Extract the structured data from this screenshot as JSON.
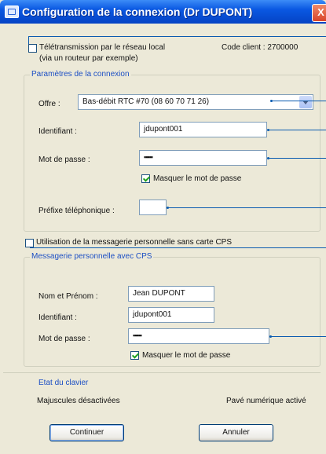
{
  "window": {
    "title": "Configuration de la connexion (Dr DUPONT)",
    "close_glyph": "X"
  },
  "telematic": {
    "checkbox_label_line1": "Télétransmission par le réseau local",
    "checkbox_label_line2": "(via un routeur par exemple)",
    "checked": false,
    "client_code_label": "Code client : 2700000"
  },
  "connection": {
    "group_title": "Paramètres de la connexion",
    "offer_label": "Offre :",
    "offer_value": "Bas-débit RTC #70 (08 60 70 71 26)",
    "identifier_label": "Identifiant :",
    "identifier_value": "jdupont001",
    "password_label": "Mot de passe :",
    "password_value": "▪▪▪▪▪",
    "mask_password_label": "Masquer le mot de passe",
    "mask_password_checked": true,
    "phone_prefix_label": "Préfixe téléphonique :",
    "phone_prefix_value": ""
  },
  "messaging": {
    "checkbox_label": "Utilisation de la  messagerie personnelle sans carte CPS",
    "checked": false,
    "group_title": "Messagerie personnelle avec CPS",
    "name_label": "Nom et Prénom :",
    "name_value": "Jean DUPONT",
    "identifier_label": "Identifiant :",
    "identifier_value": "jdupont001",
    "password_label": "Mot de passe :",
    "password_value": "▪▪▪▪▪",
    "mask_password_label": "Masquer le mot de passe",
    "mask_password_checked": true
  },
  "keyboard": {
    "group_title": "Etat du clavier",
    "caps_status": "Majuscules désactivées",
    "numpad_status": "Pavé numérique activé"
  },
  "buttons": {
    "continue_label": "Continuer",
    "cancel_label": "Annuler"
  },
  "icons": {
    "title_icon": "connection-window-icon",
    "close_icon": "close-icon",
    "dropdown_icon": "chevron-down-icon"
  },
  "colors": {
    "titlebar": "#0a58e2",
    "group_title": "#1c4fc4",
    "callout": "#0a5bb0",
    "close": "#d8442a",
    "check": "#21a121"
  }
}
